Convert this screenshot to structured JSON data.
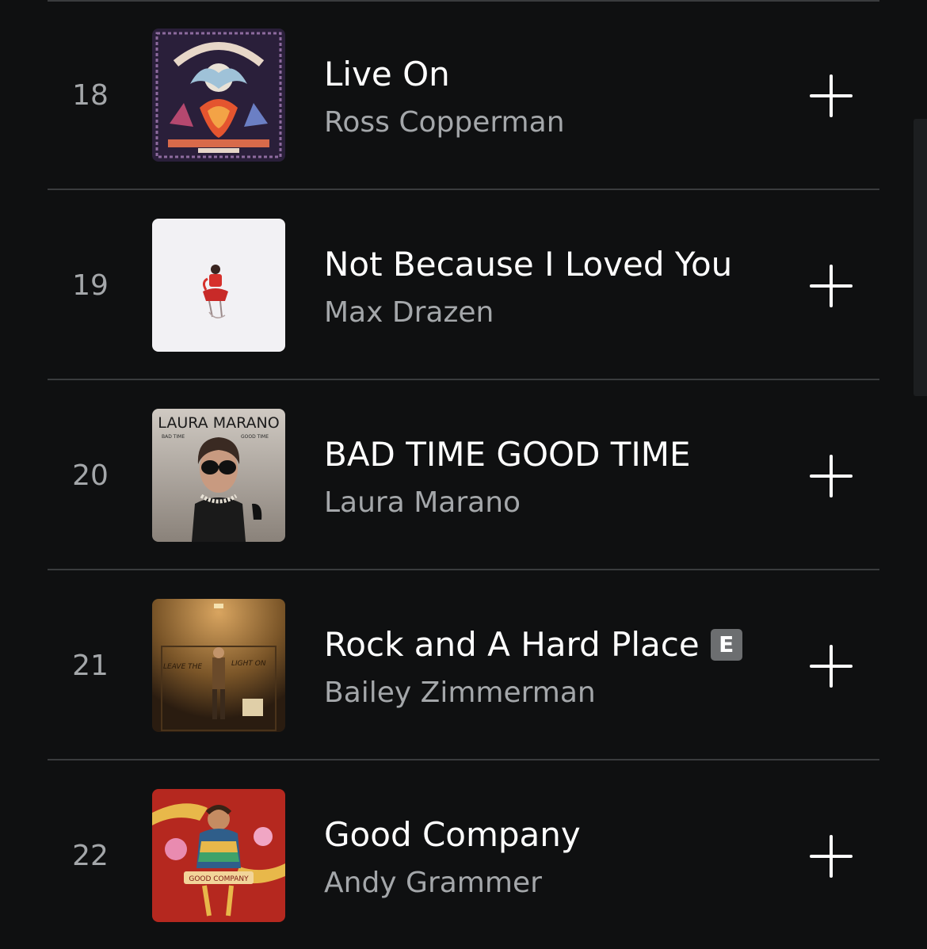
{
  "colors": {
    "background": "#0f1011",
    "divider": "#3a3c3e",
    "title": "#ffffff",
    "secondary_text": "#a4a7aa",
    "explicit_badge": "#6c6e70"
  },
  "tracks": [
    {
      "rank": "18",
      "title": "Live On",
      "artist": "Ross Copperman",
      "explicit": false,
      "album_art": "ross-copperman-human-cover"
    },
    {
      "rank": "19",
      "title": "Not Because I Loved You",
      "artist": "Max Drazen",
      "explicit": false,
      "album_art": "max-drazen-white-cover"
    },
    {
      "rank": "20",
      "title": "BAD TIME GOOD TIME",
      "artist": "Laura Marano",
      "explicit": false,
      "album_art": "laura-marano-bad-time-good-time-cover",
      "art_text": {
        "header": "LAURA MARANO",
        "left": "BAD TIME",
        "right": "GOOD TIME"
      }
    },
    {
      "rank": "21",
      "title": "Rock and A Hard Place",
      "artist": "Bailey Zimmerman",
      "explicit": true,
      "explicit_label": "E",
      "album_art": "bailey-zimmerman-leave-the-light-on-cover",
      "art_text": {
        "left": "LEAVE THE",
        "right": "LIGHT ON"
      }
    },
    {
      "rank": "22",
      "title": "Good Company",
      "artist": "Andy Grammer",
      "explicit": false,
      "album_art": "andy-grammer-good-company-cover",
      "art_text": {
        "banner": "GOOD COMPANY"
      }
    }
  ],
  "add_icon": "plus-icon"
}
